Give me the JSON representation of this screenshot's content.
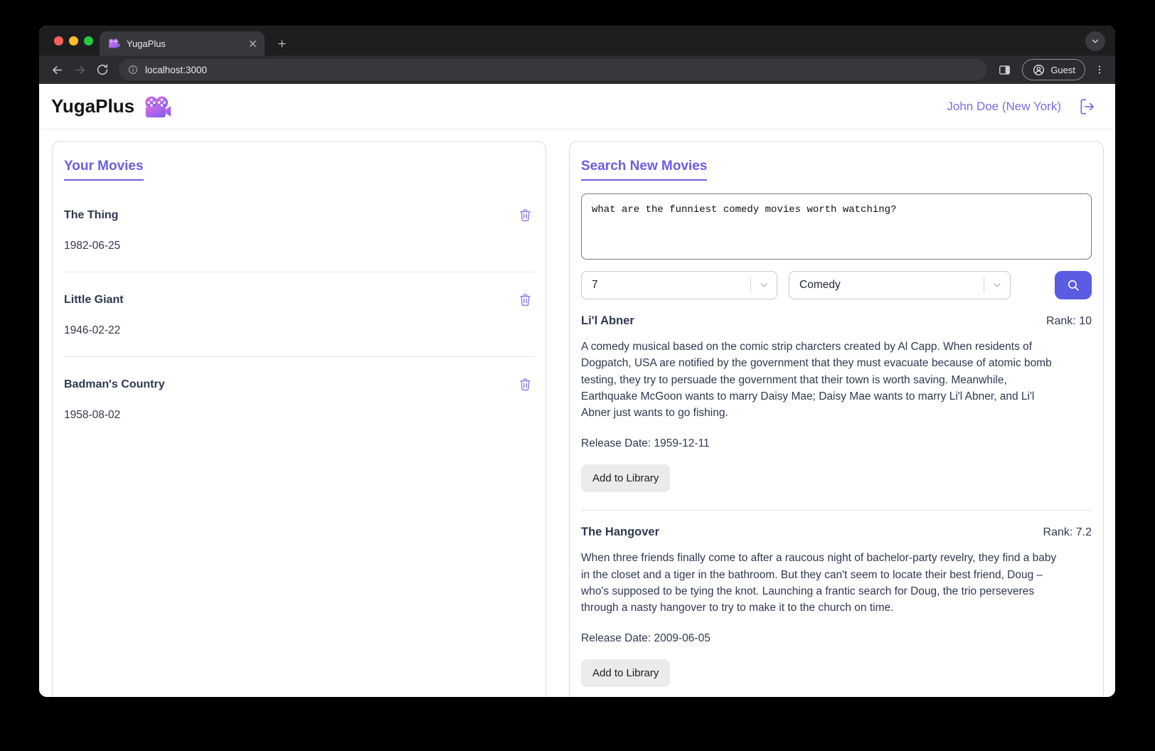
{
  "browser": {
    "tab_title": "YugaPlus",
    "url": "localhost:3000",
    "guest_label": "Guest"
  },
  "app_header": {
    "brand": "YugaPlus",
    "user": "John Doe (New York)"
  },
  "your_movies": {
    "heading": "Your Movies",
    "items": [
      {
        "title": "The Thing",
        "date": "1982-06-25"
      },
      {
        "title": "Little Giant",
        "date": "1946-02-22"
      },
      {
        "title": "Badman's Country",
        "date": "1958-08-02"
      }
    ]
  },
  "search": {
    "heading": "Search New Movies",
    "query": "what are the funniest comedy movies worth watching?",
    "rank_value": "7",
    "category_value": "Comedy",
    "add_button": "Add to Library",
    "results": [
      {
        "title": "Li'l Abner",
        "rank": "Rank: 10",
        "description": "A comedy musical based on the comic strip charcters created by Al Capp. When residents of Dogpatch, USA are notified by the government that they must evacuate because of atomic bomb testing, they try to persuade the government that their town is worth saving. Meanwhile, Earthquake McGoon wants to marry Daisy Mae; Daisy Mae wants to marry Li'l Abner, and Li'l Abner just wants to go fishing.",
        "release": "Release Date: 1959-12-11"
      },
      {
        "title": "The Hangover",
        "rank": "Rank: 7.2",
        "description": "When three friends finally come to after a raucous night of bachelor-party revelry, they find a baby in the closet and a tiger in the bathroom. But they can't seem to locate their best friend, Doug – who's supposed to be tying the knot. Launching a frantic search for Doug, the trio perseveres through a nasty hangover to try to make it to the church on time.",
        "release": "Release Date: 2009-06-05"
      }
    ]
  },
  "colors": {
    "accent_purple": "#6d5ce6",
    "search_button": "#5b5be4",
    "trash_icon": "#8b7cf0",
    "body_text": "#2e3950"
  },
  "icons": {
    "favicon": "movie-camera",
    "logout": "logout-arrow",
    "delete": "trash",
    "search": "magnifier",
    "select": "chevron-down"
  }
}
